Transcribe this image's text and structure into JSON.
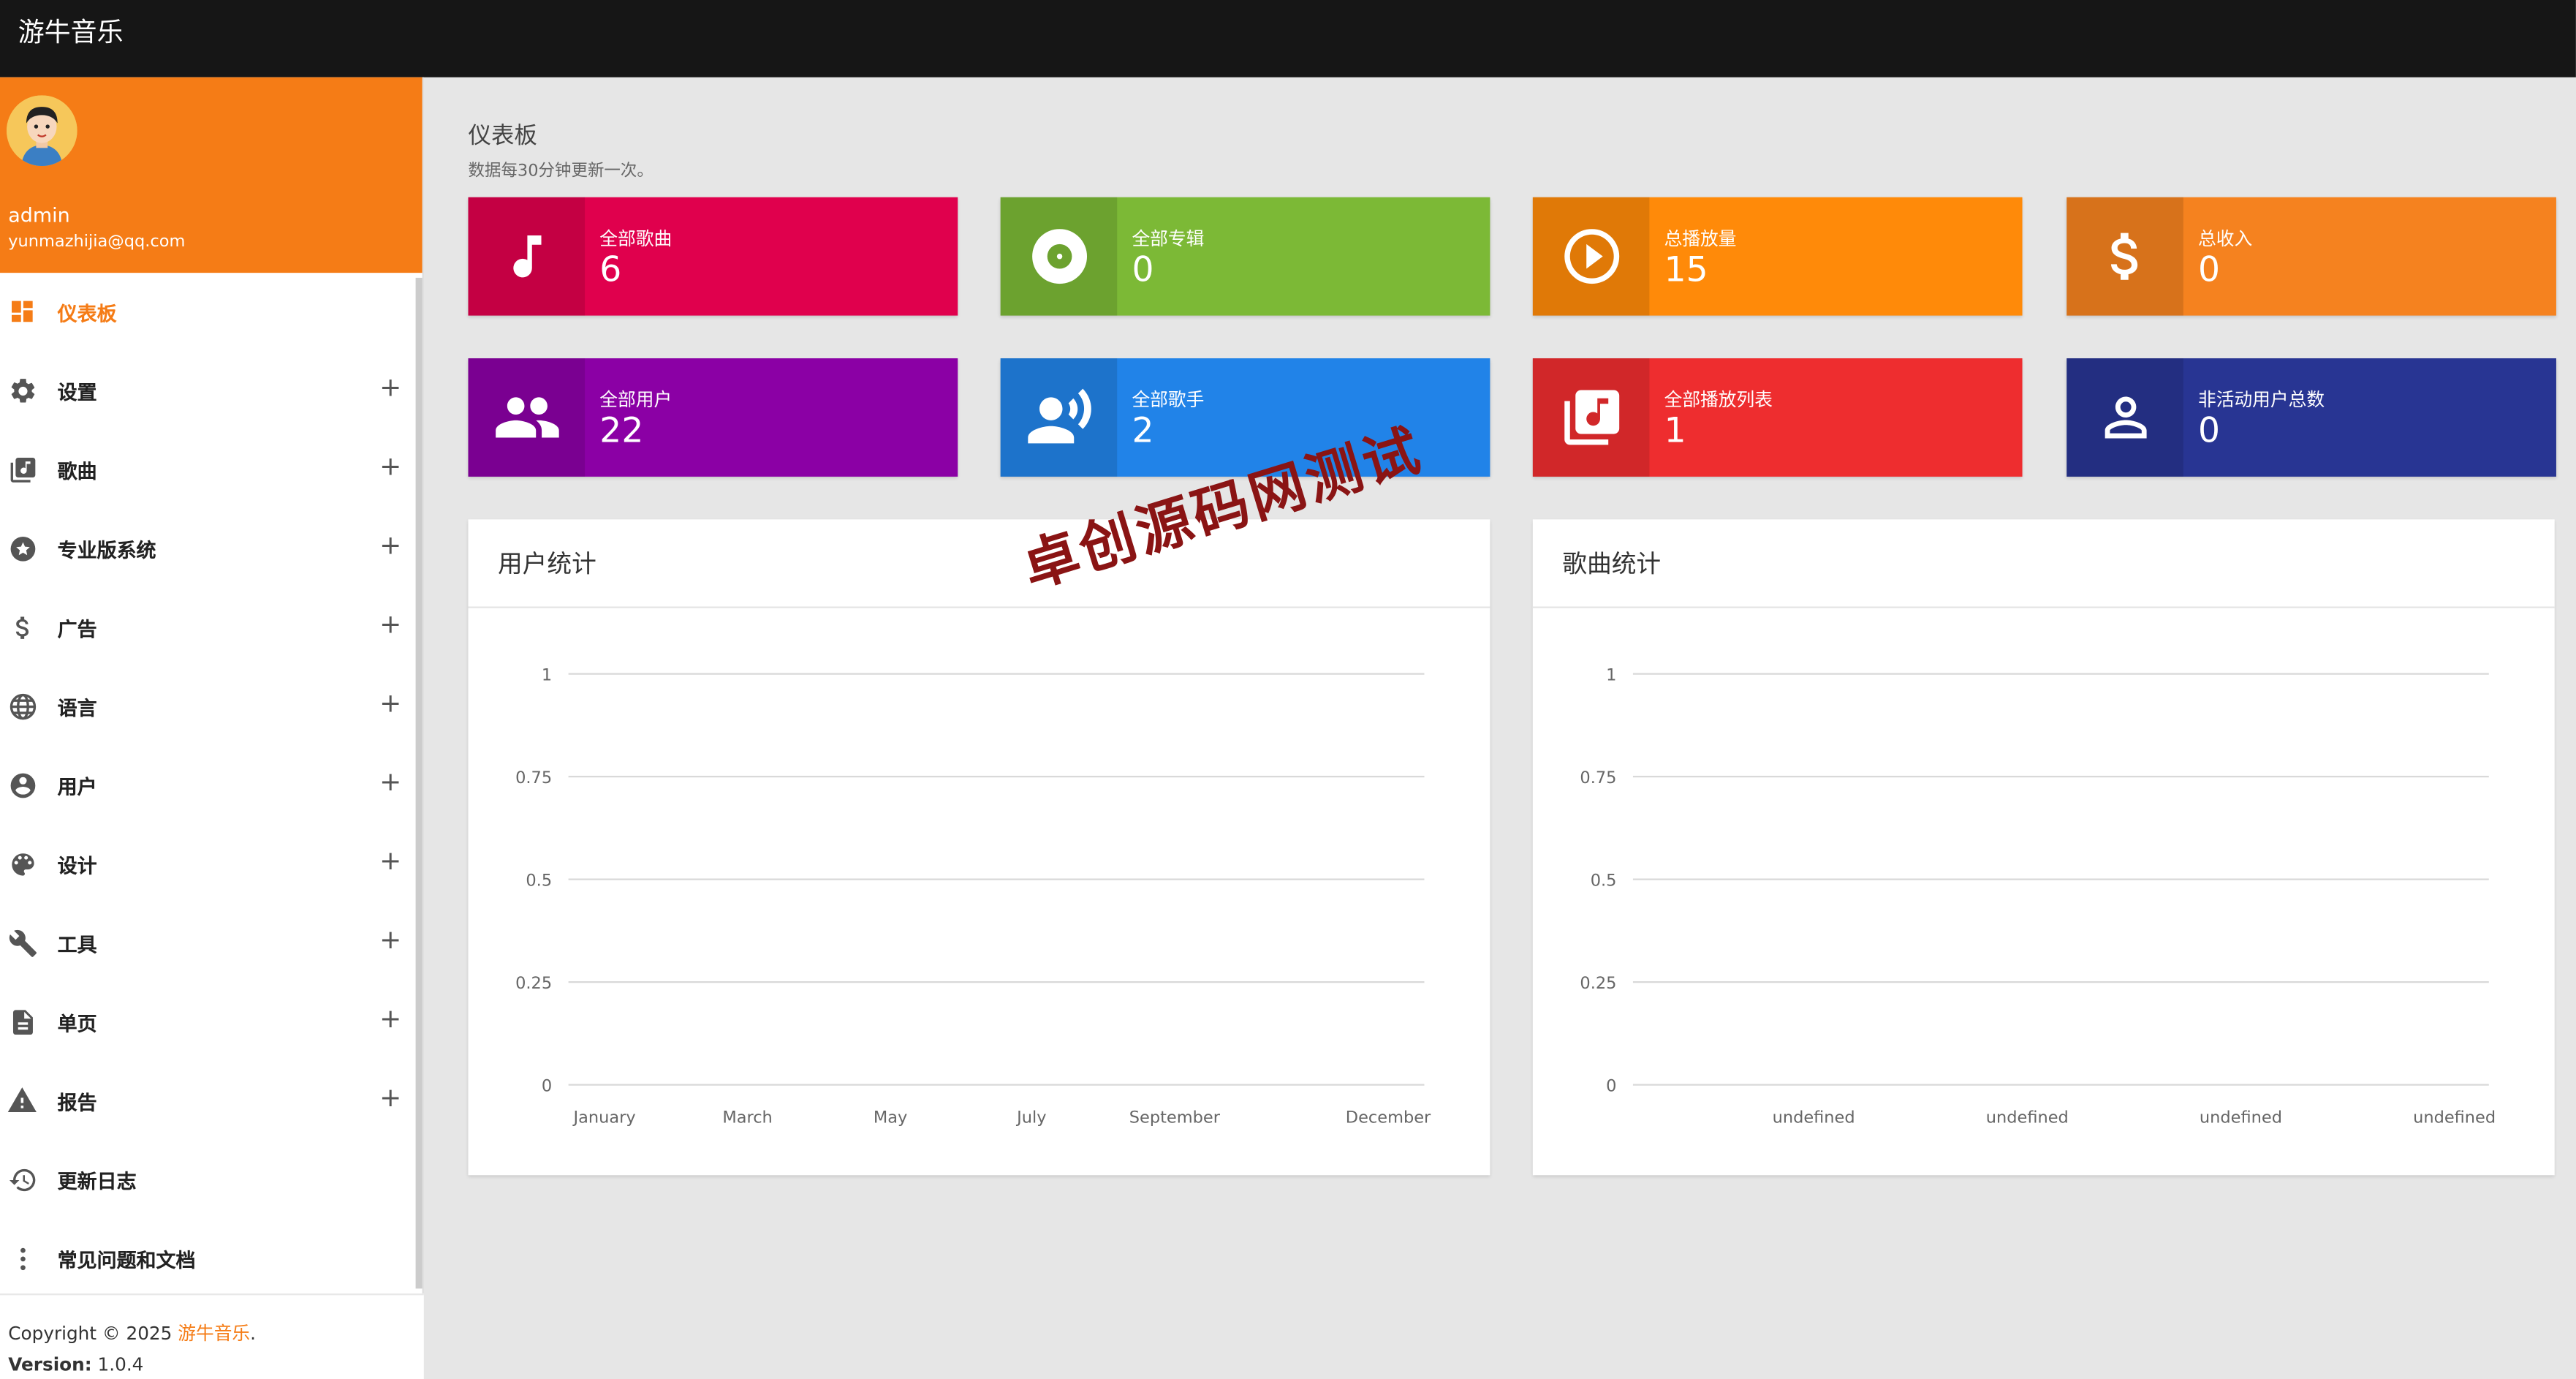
{
  "app": {
    "title": "游牛音乐"
  },
  "profile": {
    "username": "admin",
    "email": "yunmazhijia@qq.com"
  },
  "sidebar": {
    "items": [
      {
        "label": "仪表板",
        "icon": "dashboard-icon",
        "expandable": false,
        "active": true
      },
      {
        "label": "设置",
        "icon": "gear-icon",
        "expandable": true
      },
      {
        "label": "歌曲",
        "icon": "music-library-icon",
        "expandable": true
      },
      {
        "label": "专业版系统",
        "icon": "star-badge-icon",
        "expandable": true
      },
      {
        "label": "广告",
        "icon": "dollar-icon",
        "expandable": true
      },
      {
        "label": "语言",
        "icon": "globe-icon",
        "expandable": true
      },
      {
        "label": "用户",
        "icon": "user-circle-icon",
        "expandable": true
      },
      {
        "label": "设计",
        "icon": "palette-icon",
        "expandable": true
      },
      {
        "label": "工具",
        "icon": "wrench-icon",
        "expandable": true
      },
      {
        "label": "单页",
        "icon": "document-icon",
        "expandable": true
      },
      {
        "label": "报告",
        "icon": "warning-icon",
        "expandable": true
      },
      {
        "label": "更新日志",
        "icon": "history-icon",
        "expandable": false
      },
      {
        "label": "常见问题和文档",
        "icon": "more-vertical-icon",
        "expandable": false
      }
    ],
    "plus": "+"
  },
  "footer": {
    "copyright": "Copyright © 2025 ",
    "brand": "游牛音乐",
    "dot": ".",
    "version_label": "Version:",
    "version": " 1.0.4"
  },
  "page": {
    "title": "仪表板",
    "subtitle": "数据每30分钟更新一次。"
  },
  "stats": [
    {
      "label": "全部歌曲",
      "value": "6",
      "color": "#e0004d",
      "icon": "music-note-icon"
    },
    {
      "label": "全部专辑",
      "value": "0",
      "color": "#7cb936",
      "icon": "disc-icon"
    },
    {
      "label": "总播放量",
      "value": "15",
      "color": "#ff8a09",
      "icon": "play-circle-icon"
    },
    {
      "label": "总收入",
      "value": "0",
      "color": "#f5821f",
      "icon": "dollar-icon"
    },
    {
      "label": "全部用户",
      "value": "22",
      "color": "#8b00a5",
      "icon": "users-icon"
    },
    {
      "label": "全部歌手",
      "value": "2",
      "color": "#2183e8",
      "icon": "singer-icon"
    },
    {
      "label": "全部播放列表",
      "value": "1",
      "color": "#ee2d2f",
      "icon": "playlist-icon"
    },
    {
      "label": "非活动用户总数",
      "value": "0",
      "color": "#283593",
      "icon": "user-outline-icon"
    }
  ],
  "watermark": "卓创源码网测试",
  "chart_data": [
    {
      "type": "line",
      "title": "用户统计",
      "categories": [
        "January",
        "March",
        "May",
        "July",
        "September",
        "December"
      ],
      "yticks": [
        "0",
        "0.25",
        "0.5",
        "0.75",
        "1"
      ],
      "ylim": [
        0,
        1
      ],
      "series": [],
      "grid": true
    },
    {
      "type": "line",
      "title": "歌曲统计",
      "categories": [
        "undefined",
        "undefined",
        "undefined",
        "undefined"
      ],
      "yticks": [
        "0",
        "0.25",
        "0.5",
        "0.75",
        "1"
      ],
      "ylim": [
        0,
        1
      ],
      "series": [],
      "grid": true
    }
  ]
}
